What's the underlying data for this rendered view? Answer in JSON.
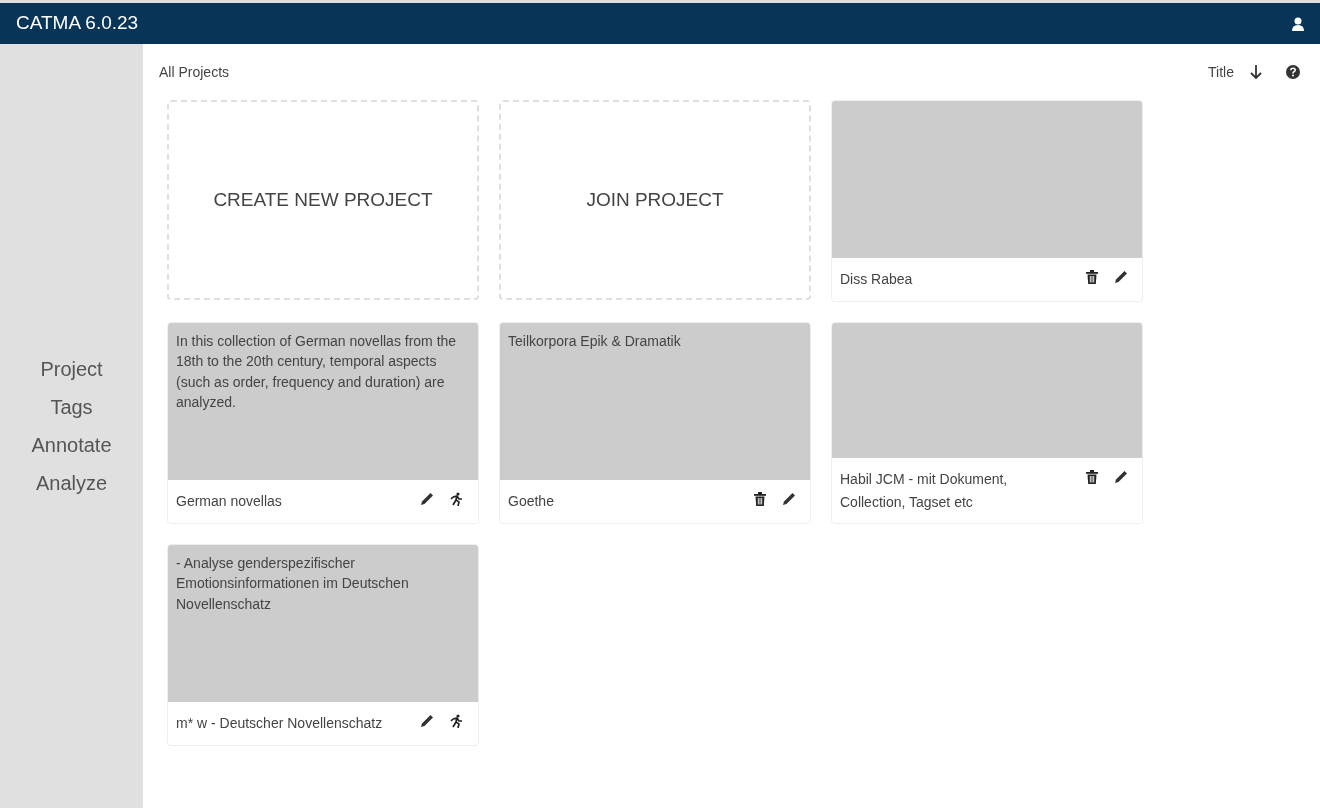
{
  "app_title": "CATMA 6.0.23",
  "sidebar": {
    "items": [
      "Project",
      "Tags",
      "Annotate",
      "Analyze"
    ]
  },
  "toolbar": {
    "breadcrumb": "All Projects",
    "sort_label": "Title"
  },
  "actions": [
    {
      "label": "CREATE NEW PROJECT"
    },
    {
      "label": "JOIN PROJECT"
    }
  ],
  "projects": [
    {
      "name": "Diss Rabea",
      "tools": [
        {
          "kind": "delete"
        },
        {
          "kind": "edit"
        }
      ]
    },
    {
      "name": "German novellas",
      "description": "In this collection of German novellas from the 18th to the 20th century, temporal aspects (such as order, frequency and duration) are analyzed.",
      "tools": [
        {
          "kind": "edit"
        },
        {
          "kind": "leave"
        }
      ]
    },
    {
      "name": "Goethe",
      "description": "Teilkorpora Epik & Dramatik",
      "tools": [
        {
          "kind": "delete"
        },
        {
          "kind": "edit"
        }
      ]
    },
    {
      "name": "Habil JCM - mit Dokument, Collection, Tagset etc",
      "tools": [
        {
          "kind": "delete"
        },
        {
          "kind": "edit"
        }
      ]
    },
    {
      "name": "m* w - Deutscher Novellenschatz",
      "description": "- Analyse genderspezifischer Emotionsinformationen im Deutschen Novellenschatz",
      "tools": [
        {
          "kind": "edit"
        },
        {
          "kind": "leave"
        }
      ]
    }
  ]
}
